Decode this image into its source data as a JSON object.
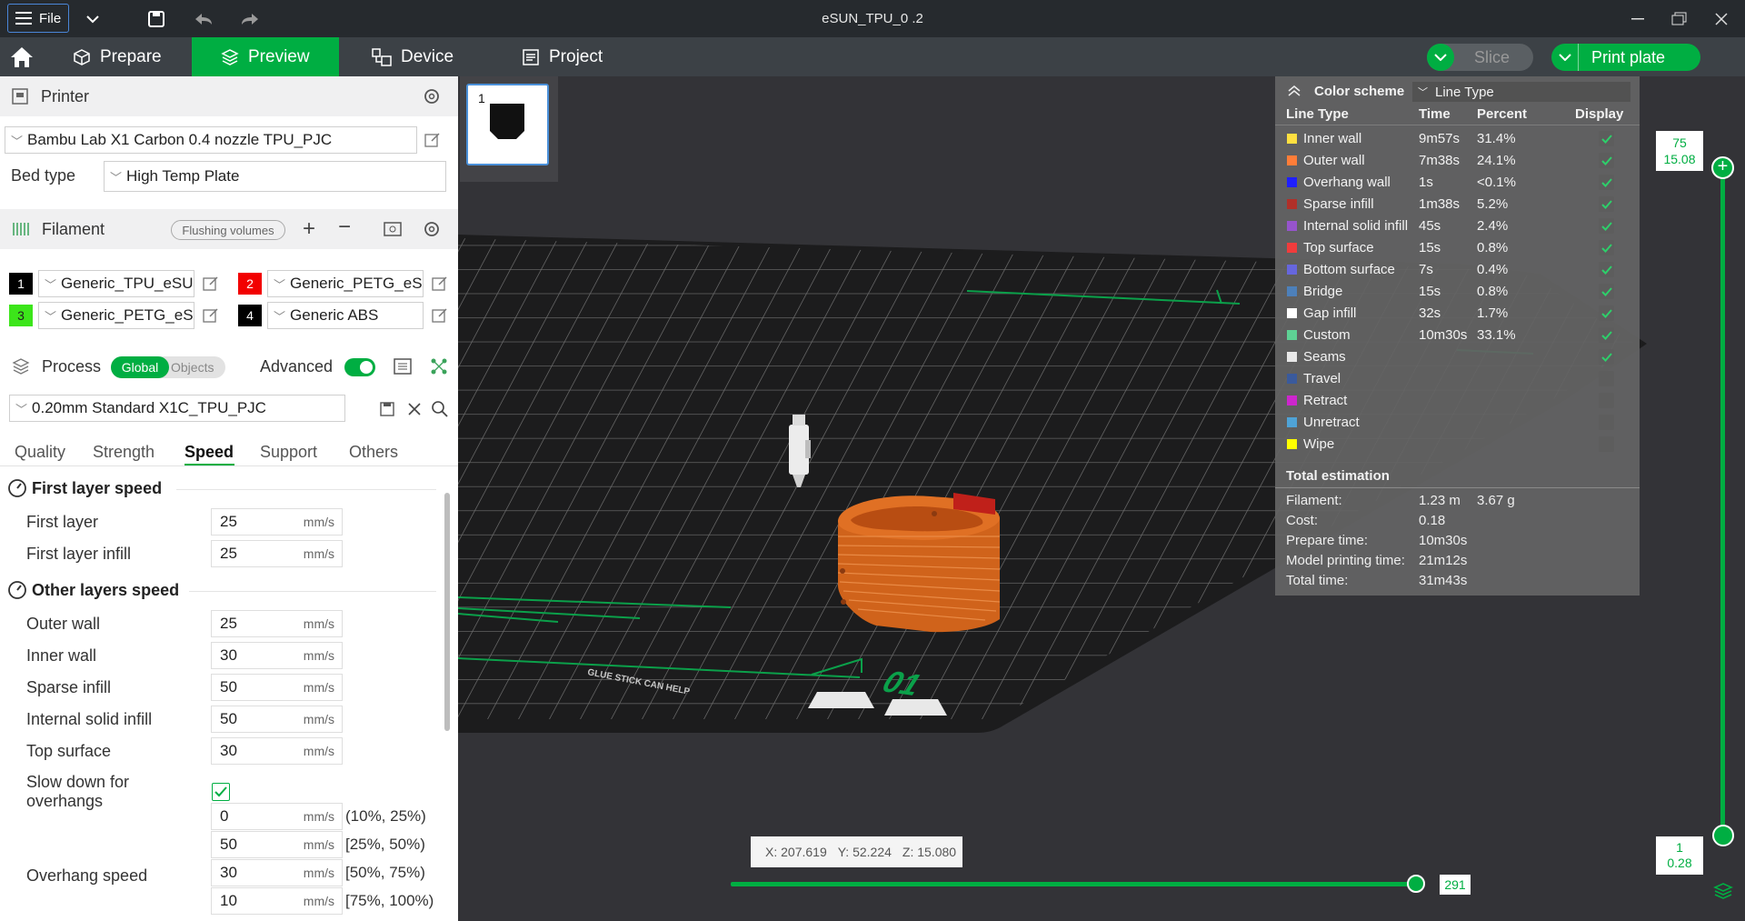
{
  "titlebar": {
    "file_label": "File",
    "title": "eSUN_TPU_0 .2"
  },
  "nav": {
    "tabs": [
      {
        "label": "Prepare"
      },
      {
        "label": "Preview"
      },
      {
        "label": "Device"
      },
      {
        "label": "Project"
      }
    ],
    "slice_label": "Slice",
    "print_label": "Print plate"
  },
  "printer": {
    "section_label": "Printer",
    "preset": "Bambu Lab X1 Carbon 0.4 nozzle TPU_PJC",
    "bed_type_label": "Bed type",
    "bed_type": "High Temp Plate"
  },
  "filament": {
    "section_label": "Filament",
    "flushing_label": "Flushing volumes",
    "items": [
      {
        "num": "1",
        "name": "Generic_TPU_eSU...",
        "color": "#000000",
        "text_color": "#ffffff"
      },
      {
        "num": "2",
        "name": "Generic_PETG_eS...",
        "color": "#f20000",
        "text_color": "#ffffff"
      },
      {
        "num": "3",
        "name": "Generic_PETG_eS...",
        "color": "#3ce51a",
        "text_color": "#222222"
      },
      {
        "num": "4",
        "name": "Generic ABS",
        "color": "#000000",
        "text_color": "#ffffff"
      }
    ]
  },
  "process": {
    "section_label": "Process",
    "global_label": "Global",
    "objects_label": "Objects",
    "advanced_label": "Advanced",
    "preset": "0.20mm Standard X1C_TPU_PJC",
    "tabs": [
      {
        "label": "Quality"
      },
      {
        "label": "Strength"
      },
      {
        "label": "Speed"
      },
      {
        "label": "Support"
      },
      {
        "label": "Others"
      }
    ],
    "first_layer_speed": {
      "title": "First layer speed",
      "rows": [
        {
          "label": "First layer",
          "value": "25",
          "unit": "mm/s"
        },
        {
          "label": "First layer infill",
          "value": "25",
          "unit": "mm/s"
        }
      ]
    },
    "other_layers_speed": {
      "title": "Other layers speed",
      "rows": [
        {
          "label": "Outer wall",
          "value": "25",
          "unit": "mm/s"
        },
        {
          "label": "Inner wall",
          "value": "30",
          "unit": "mm/s"
        },
        {
          "label": "Sparse infill",
          "value": "50",
          "unit": "mm/s"
        },
        {
          "label": "Internal solid infill",
          "value": "50",
          "unit": "mm/s"
        },
        {
          "label": "Top surface",
          "value": "30",
          "unit": "mm/s"
        }
      ]
    },
    "slow_down_label": "Slow down for overhangs",
    "slow_down_checked": true,
    "overhang_speed_label": "Overhang speed",
    "overhang_rows": [
      {
        "value": "0",
        "unit": "mm/s",
        "range": "(10%, 25%)"
      },
      {
        "value": "50",
        "unit": "mm/s",
        "range": "[25%, 50%)"
      },
      {
        "value": "30",
        "unit": "mm/s",
        "range": "[50%, 75%)"
      },
      {
        "value": "10",
        "unit": "mm/s",
        "range": "[75%, 100%)"
      }
    ]
  },
  "plate": {
    "number": "1"
  },
  "color_scheme": {
    "title": "Color scheme",
    "mode": "Line Type",
    "headers": {
      "type": "Line Type",
      "time": "Time",
      "percent": "Percent",
      "display": "Display"
    },
    "rows": [
      {
        "name": "Inner wall",
        "time": "9m57s",
        "percent": "31.4%",
        "color": "#ffe040",
        "checked": true
      },
      {
        "name": "Outer wall",
        "time": "7m38s",
        "percent": "24.1%",
        "color": "#ff7d38",
        "checked": true
      },
      {
        "name": "Overhang wall",
        "time": "1s",
        "percent": "<0.1%",
        "color": "#1f1fff",
        "checked": true
      },
      {
        "name": "Sparse infill",
        "time": "1m38s",
        "percent": "5.2%",
        "color": "#b03029",
        "checked": true
      },
      {
        "name": "Internal solid infill",
        "time": "45s",
        "percent": "2.4%",
        "color": "#9654cc",
        "checked": true
      },
      {
        "name": "Top surface",
        "time": "15s",
        "percent": "0.8%",
        "color": "#f03c3c",
        "checked": true
      },
      {
        "name": "Bottom surface",
        "time": "7s",
        "percent": "0.4%",
        "color": "#6666dd",
        "checked": true
      },
      {
        "name": "Bridge",
        "time": "15s",
        "percent": "0.8%",
        "color": "#4d80ba",
        "checked": true
      },
      {
        "name": "Gap infill",
        "time": "32s",
        "percent": "1.7%",
        "color": "#ffffff",
        "checked": true
      },
      {
        "name": "Custom",
        "time": "10m30s",
        "percent": "33.1%",
        "color": "#5ed194",
        "checked": true
      },
      {
        "name": "Seams",
        "time": "",
        "percent": "",
        "color": "#e8e8e8",
        "checked": true
      },
      {
        "name": "Travel",
        "time": "",
        "percent": "",
        "color": "#3a5a9c",
        "checked": false
      },
      {
        "name": "Retract",
        "time": "",
        "percent": "",
        "color": "#cd26cd",
        "checked": false
      },
      {
        "name": "Unretract",
        "time": "",
        "percent": "",
        "color": "#4fa3d6",
        "checked": false
      },
      {
        "name": "Wipe",
        "time": "",
        "percent": "",
        "color": "#ffff00",
        "checked": false
      }
    ],
    "total_label": "Total estimation",
    "filament_label": "Filament:",
    "filament_length": "1.23 m",
    "filament_weight": "3.67 g",
    "cost_label": "Cost:",
    "cost": "0.18",
    "prepare_label": "Prepare time:",
    "prepare": "10m30s",
    "model_label": "Model printing time:",
    "model": "21m12s",
    "total_time_label": "Total time:",
    "total_time": "31m43s"
  },
  "layer_slider": {
    "top_layer": "75",
    "top_height": "15.08",
    "bottom_layer": "1",
    "bottom_height": "0.28"
  },
  "move_slider": {
    "value": "291"
  },
  "coords": {
    "x": "X: 207.619",
    "y": "Y: 52.224",
    "z": "Z: 15.080"
  },
  "bed": {
    "plate_number": "01",
    "text": "GLUE STICK CAN HELP"
  },
  "colors": {
    "accent": "#00ae42",
    "titlebar": "#262a2e",
    "navbar": "#3c4146",
    "viewport": "#333337"
  }
}
